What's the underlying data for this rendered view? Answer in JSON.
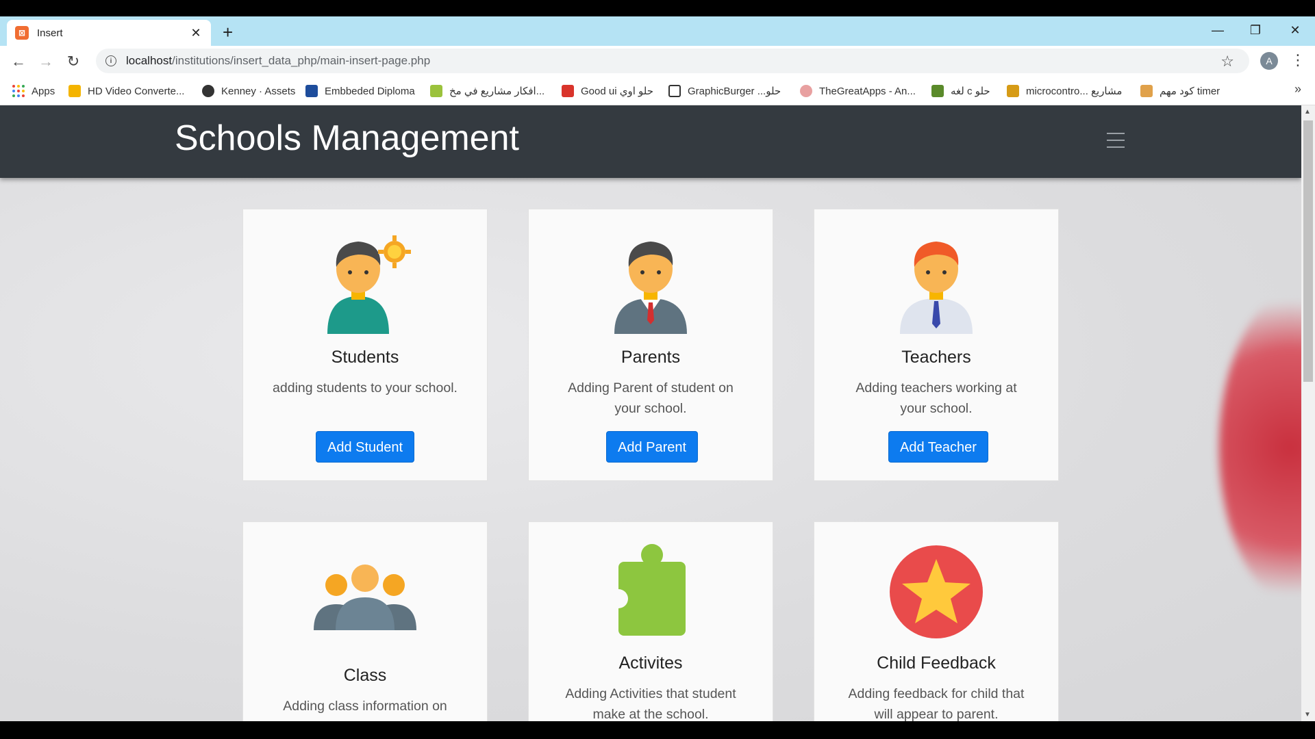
{
  "browser": {
    "tab_title": "Insert",
    "url_host": "localhost",
    "url_path": "/institutions/insert_data_php/main-insert-page.php",
    "profile_initial": "A",
    "bookmarks": [
      "Apps",
      "HD Video Converte...",
      "Kenney · Assets",
      "Embbeded Diploma",
      "افكار مشاريع في مخ...",
      "Good ui حلو اوي",
      "GraphicBurger ...حلو",
      "TheGreatApps - An...",
      "لغه c حلو",
      "microcontro... مشاريع",
      "كود مهم timer"
    ]
  },
  "navbar": {
    "brand": "Schools Management"
  },
  "cards": [
    {
      "title": "Students",
      "text": "adding students to your school.",
      "button": "Add Student"
    },
    {
      "title": "Parents",
      "text": "Adding Parent of student on your school.",
      "button": "Add Parent"
    },
    {
      "title": "Teachers",
      "text": "Adding teachers working at your school.",
      "button": "Add Teacher"
    },
    {
      "title": "Class",
      "text": "Adding class information on your school."
    },
    {
      "title": "Activites",
      "text": "Adding Activities that student make at the school."
    },
    {
      "title": "Child Feedback",
      "text": "Adding feedback for child that will appear to parent."
    }
  ],
  "colors": {
    "navbar": "#343a40",
    "button": "#0d7bef",
    "tabstrip": "#b5e3f4"
  }
}
